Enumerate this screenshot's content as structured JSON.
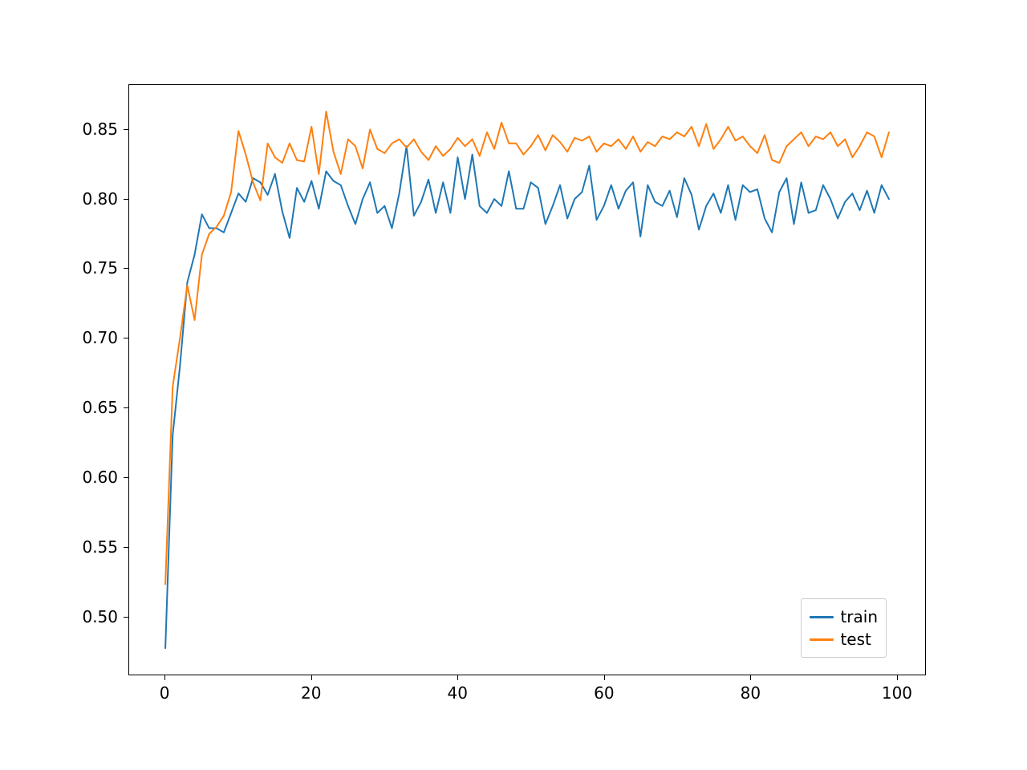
{
  "chart_data": {
    "type": "line",
    "title": "",
    "xlabel": "",
    "ylabel": "",
    "xlim": [
      -4.95,
      103.95
    ],
    "ylim": [
      0.458,
      0.882
    ],
    "x_ticks": [
      0,
      20,
      40,
      60,
      80,
      100
    ],
    "y_ticks": [
      0.5,
      0.55,
      0.6,
      0.65,
      0.7,
      0.75,
      0.8,
      0.85
    ],
    "x": [
      0,
      1,
      2,
      3,
      4,
      5,
      6,
      7,
      8,
      9,
      10,
      11,
      12,
      13,
      14,
      15,
      16,
      17,
      18,
      19,
      20,
      21,
      22,
      23,
      24,
      25,
      26,
      27,
      28,
      29,
      30,
      31,
      32,
      33,
      34,
      35,
      36,
      37,
      38,
      39,
      40,
      41,
      42,
      43,
      44,
      45,
      46,
      47,
      48,
      49,
      50,
      51,
      52,
      53,
      54,
      55,
      56,
      57,
      58,
      59,
      60,
      61,
      62,
      63,
      64,
      65,
      66,
      67,
      68,
      69,
      70,
      71,
      72,
      73,
      74,
      75,
      76,
      77,
      78,
      79,
      80,
      81,
      82,
      83,
      84,
      85,
      86,
      87,
      88,
      89,
      90,
      91,
      92,
      93,
      94,
      95,
      96,
      97,
      98,
      99
    ],
    "series": [
      {
        "name": "train",
        "color": "#1f77b4",
        "values": [
          0.477,
          0.63,
          0.68,
          0.74,
          0.76,
          0.789,
          0.779,
          0.779,
          0.776,
          0.79,
          0.804,
          0.798,
          0.815,
          0.812,
          0.803,
          0.818,
          0.791,
          0.772,
          0.808,
          0.798,
          0.813,
          0.793,
          0.82,
          0.813,
          0.81,
          0.795,
          0.782,
          0.8,
          0.812,
          0.79,
          0.795,
          0.779,
          0.804,
          0.838,
          0.788,
          0.798,
          0.814,
          0.79,
          0.812,
          0.79,
          0.83,
          0.8,
          0.832,
          0.795,
          0.79,
          0.8,
          0.795,
          0.82,
          0.793,
          0.793,
          0.812,
          0.808,
          0.782,
          0.795,
          0.81,
          0.786,
          0.8,
          0.805,
          0.824,
          0.785,
          0.795,
          0.81,
          0.793,
          0.806,
          0.812,
          0.773,
          0.81,
          0.798,
          0.795,
          0.806,
          0.787,
          0.815,
          0.803,
          0.778,
          0.795,
          0.804,
          0.79,
          0.81,
          0.785,
          0.81,
          0.805,
          0.807,
          0.786,
          0.776,
          0.805,
          0.815,
          0.782,
          0.812,
          0.79,
          0.792,
          0.81,
          0.8,
          0.786,
          0.798,
          0.804,
          0.792,
          0.806,
          0.79,
          0.81,
          0.8
        ]
      },
      {
        "name": "test",
        "color": "#ff7f0e",
        "values": [
          0.523,
          0.665,
          0.7,
          0.738,
          0.713,
          0.76,
          0.775,
          0.78,
          0.788,
          0.805,
          0.849,
          0.832,
          0.812,
          0.799,
          0.84,
          0.83,
          0.826,
          0.84,
          0.828,
          0.827,
          0.852,
          0.818,
          0.863,
          0.834,
          0.818,
          0.843,
          0.838,
          0.822,
          0.85,
          0.836,
          0.833,
          0.84,
          0.843,
          0.837,
          0.843,
          0.834,
          0.828,
          0.838,
          0.831,
          0.836,
          0.844,
          0.838,
          0.843,
          0.831,
          0.848,
          0.836,
          0.855,
          0.84,
          0.84,
          0.832,
          0.838,
          0.846,
          0.835,
          0.846,
          0.841,
          0.834,
          0.844,
          0.842,
          0.845,
          0.834,
          0.84,
          0.838,
          0.843,
          0.836,
          0.845,
          0.834,
          0.841,
          0.838,
          0.845,
          0.843,
          0.848,
          0.845,
          0.852,
          0.838,
          0.854,
          0.836,
          0.843,
          0.852,
          0.842,
          0.845,
          0.838,
          0.833,
          0.846,
          0.828,
          0.826,
          0.838,
          0.843,
          0.848,
          0.838,
          0.845,
          0.843,
          0.848,
          0.838,
          0.843,
          0.83,
          0.838,
          0.848,
          0.845,
          0.83,
          0.848
        ]
      }
    ]
  },
  "legend": {
    "items": [
      {
        "label": "train",
        "color": "#1f77b4"
      },
      {
        "label": "test",
        "color": "#ff7f0e"
      }
    ]
  },
  "ticks": {
    "x": [
      {
        "v": 0,
        "label": "0"
      },
      {
        "v": 20,
        "label": "20"
      },
      {
        "v": 40,
        "label": "40"
      },
      {
        "v": 60,
        "label": "60"
      },
      {
        "v": 80,
        "label": "80"
      },
      {
        "v": 100,
        "label": "100"
      }
    ],
    "y": [
      {
        "v": 0.5,
        "label": "0.50"
      },
      {
        "v": 0.55,
        "label": "0.55"
      },
      {
        "v": 0.6,
        "label": "0.60"
      },
      {
        "v": 0.65,
        "label": "0.65"
      },
      {
        "v": 0.7,
        "label": "0.70"
      },
      {
        "v": 0.75,
        "label": "0.75"
      },
      {
        "v": 0.8,
        "label": "0.80"
      },
      {
        "v": 0.85,
        "label": "0.85"
      }
    ]
  }
}
